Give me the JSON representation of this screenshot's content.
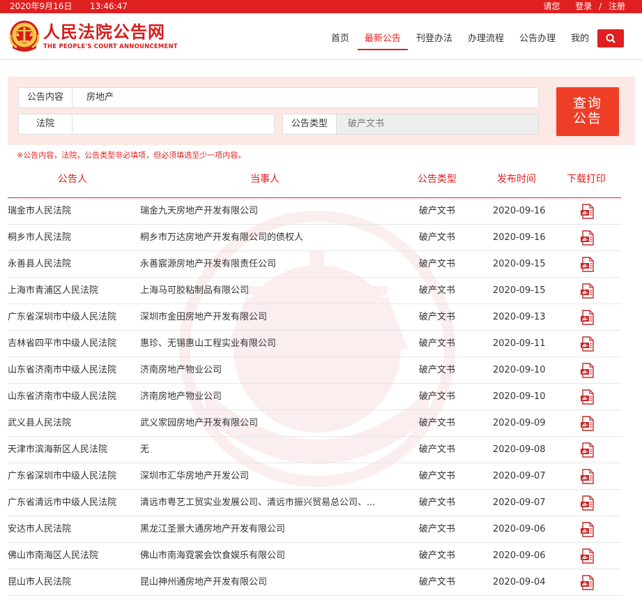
{
  "topbar": {
    "date": "2020年9月16日",
    "time": "13:46:47",
    "greeting": "请您",
    "login": "登录",
    "slash": "/",
    "register": "注册"
  },
  "brand": {
    "title_cn": "人民法院公告网",
    "title_en": "THE PEOPLE'S COURT ANNOUNCEMENT"
  },
  "nav": [
    {
      "label": "首页"
    },
    {
      "label": "最新公告"
    },
    {
      "label": "刊登办法"
    },
    {
      "label": "办理流程"
    },
    {
      "label": "公告办理"
    },
    {
      "label": "我的"
    }
  ],
  "search": {
    "content_label": "公告内容",
    "content_value": "房地产",
    "court_label": "法院",
    "court_value": "",
    "type_label": "公告类型",
    "type_value": "破产文书",
    "button_line1": "查询",
    "button_line2": "公告",
    "hint": "※公告内容，法院，公告类型非必填项，但必须填选至少一项内容。"
  },
  "table": {
    "headers": {
      "court": "公告人",
      "party": "当事人",
      "type": "公告类型",
      "date": "发布时间",
      "download": "下载打印"
    },
    "rows": [
      {
        "court": "瑞金市人民法院",
        "party": "瑞金九天房地产开发有限公司",
        "type": "破产文书",
        "date": "2020-09-16"
      },
      {
        "court": "桐乡市人民法院",
        "party": "桐乡市万达房地产开发有限公司的债权人",
        "type": "破产文书",
        "date": "2020-09-16"
      },
      {
        "court": "永善县人民法院",
        "party": "永善宸源房地产开发有限责任公司",
        "type": "破产文书",
        "date": "2020-09-15"
      },
      {
        "court": "上海市青浦区人民法院",
        "party": "上海马可胶粘制品有限公司",
        "type": "破产文书",
        "date": "2020-09-15"
      },
      {
        "court": "广东省深圳市中级人民法院",
        "party": "深圳市金田房地产开发有限公司",
        "type": "破产文书",
        "date": "2020-09-13"
      },
      {
        "court": "吉林省四平市中级人民法院",
        "party": "惠珍、无锡惠山工程实业有限公司",
        "type": "破产文书",
        "date": "2020-09-11"
      },
      {
        "court": "山东省济南市中级人民法院",
        "party": "济南房地产物业公司",
        "type": "破产文书",
        "date": "2020-09-10"
      },
      {
        "court": "山东省济南市中级人民法院",
        "party": "济南房地产物业公司",
        "type": "破产文书",
        "date": "2020-09-10"
      },
      {
        "court": "武义县人民法院",
        "party": "武义家园房地产开发有限公司",
        "type": "破产文书",
        "date": "2020-09-09"
      },
      {
        "court": "天津市滨海新区人民法院",
        "party": "无",
        "type": "破产文书",
        "date": "2020-09-08"
      },
      {
        "court": "广东省深圳市中级人民法院",
        "party": "深圳市汇华房地产开发公司",
        "type": "破产文书",
        "date": "2020-09-07"
      },
      {
        "court": "广东省清远市中级人民法院",
        "party": "清远市粤艺工贸实业发展公司、清远市振兴贸易总公司、...",
        "type": "破产文书",
        "date": "2020-09-07"
      },
      {
        "court": "安达市人民法院",
        "party": "黑龙江圣景大通房地产开发有限公司",
        "type": "破产文书",
        "date": "2020-09-06"
      },
      {
        "court": "佛山市南海区人民法院",
        "party": "佛山市南海霓裳会饮食娱乐有限公司",
        "type": "破产文书",
        "date": "2020-09-06"
      },
      {
        "court": "昆山市人民法院",
        "party": "昆山神州通房地产开发有限公司",
        "type": "破产文书",
        "date": "2020-09-04"
      }
    ]
  },
  "colors": {
    "brand_red": "#e02020",
    "panel_bg": "#fce9e5",
    "button_red": "#ef3e27"
  }
}
